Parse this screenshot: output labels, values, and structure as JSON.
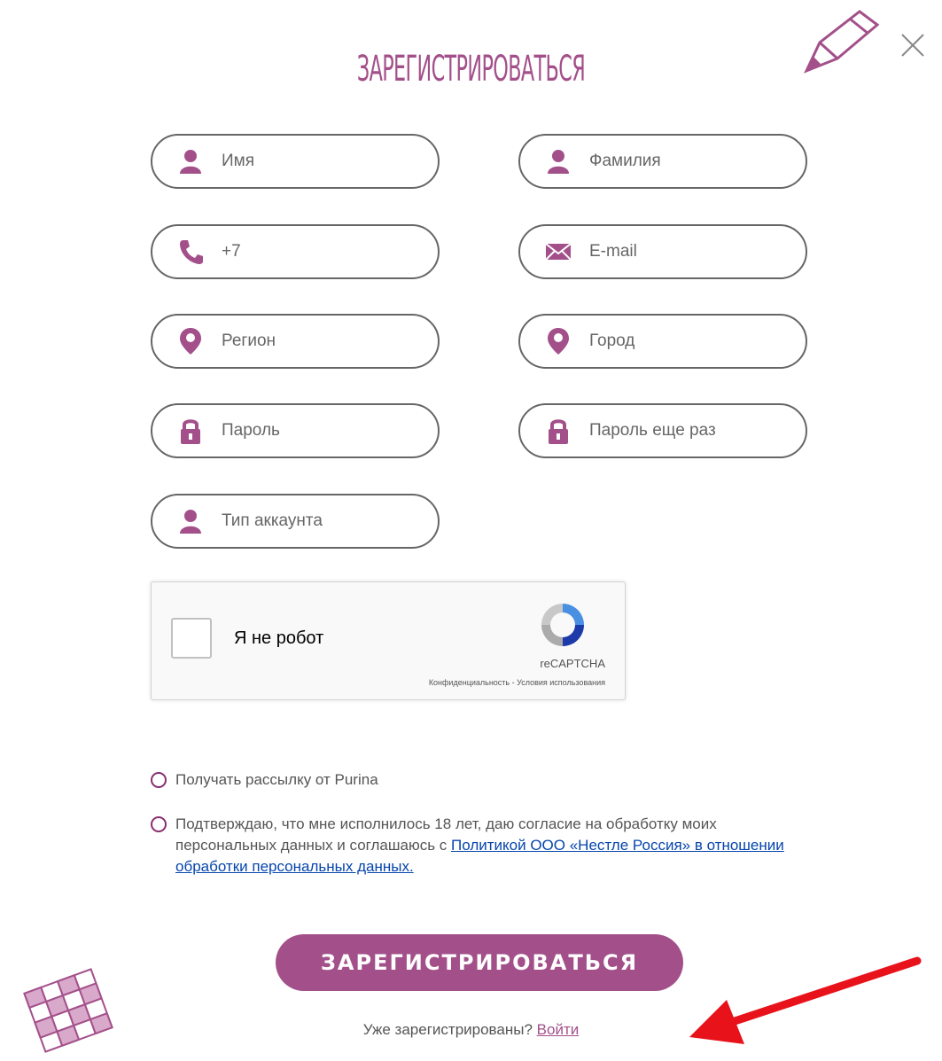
{
  "modal": {
    "title": "ЗАРЕГИСТРИРОВАТЬСЯ",
    "accent_color": "#a3508a"
  },
  "form": {
    "first_name": {
      "placeholder": "Имя",
      "icon": "user-icon"
    },
    "last_name": {
      "placeholder": "Фамилия",
      "icon": "user-icon"
    },
    "phone": {
      "placeholder": "+7",
      "icon": "phone-icon"
    },
    "email": {
      "placeholder": "E-mail",
      "icon": "envelope-icon"
    },
    "region": {
      "placeholder": "Регион",
      "icon": "location-pin-icon"
    },
    "city": {
      "placeholder": "Город",
      "icon": "location-pin-icon"
    },
    "password": {
      "placeholder": "Пароль",
      "icon": "lock-icon"
    },
    "password_repeat": {
      "placeholder": "Пароль еще раз",
      "icon": "lock-icon"
    },
    "account_type": {
      "placeholder": "Тип аккаунта",
      "icon": "user-icon"
    }
  },
  "captcha": {
    "label": "Я не робот",
    "brand": "reCAPTCHA",
    "terms": "Конфиденциальность - Условия использования"
  },
  "options": {
    "newsletter": "Получать рассылку от Purina",
    "consent_prefix": "Подтверждаю, что мне исполнилось 18 лет, даю согласие на обработку моих персональных данных и соглашаюсь с ",
    "consent_link": "Политикой ООО «Нестле Россия» в отношении обработки персональных данных."
  },
  "submit_label": "ЗАРЕГИСТРИРОВАТЬСЯ",
  "login": {
    "prompt": "Уже зарегистрированы?",
    "link": "Войти"
  },
  "annotation": {
    "arrow_color": "#e8121b"
  }
}
